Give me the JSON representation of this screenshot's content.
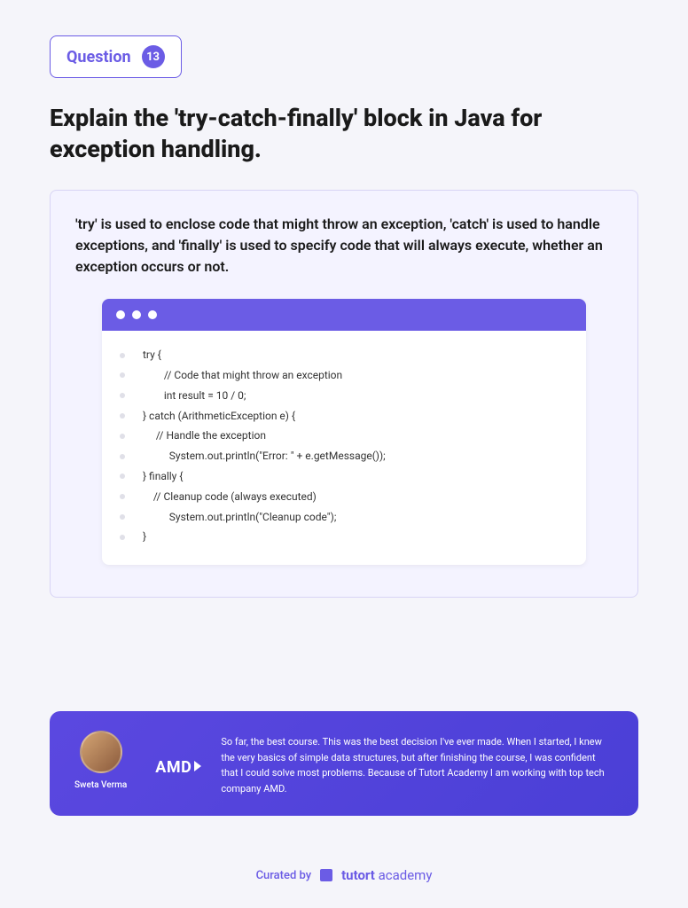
{
  "question": {
    "label": "Question",
    "number": "13",
    "title": "Explain the 'try-catch-finally' block in Java for exception handling."
  },
  "answer": {
    "text": "'try' is used to enclose code that might throw an exception, 'catch' is used to handle exceptions, and 'finally' is used to specify code that will always execute, whether an exception occurs or not."
  },
  "code": {
    "lines": [
      "try {",
      "        // Code that might throw an exception",
      "        int result = 10 / 0;",
      "} catch (ArithmeticException e) {",
      "     // Handle the exception",
      "          System.out.println(\"Error: \" + e.getMessage());",
      "} finally {",
      "    // Cleanup code (always executed)",
      "          System.out.println(\"Cleanup code\");",
      "}"
    ]
  },
  "testimonial": {
    "name": "Sweta Verma",
    "company": "AMD",
    "text": "So far, the best course. This was the best decision I've ever made. When I started, I knew the very basics of simple data structures, but after finishing the course, I was confident that I could solve most problems. Because of Tutort Academy I am working with top tech company AMD."
  },
  "footer": {
    "curated_by": "Curated by",
    "brand_bold": "tutort",
    "brand_light": " academy"
  }
}
